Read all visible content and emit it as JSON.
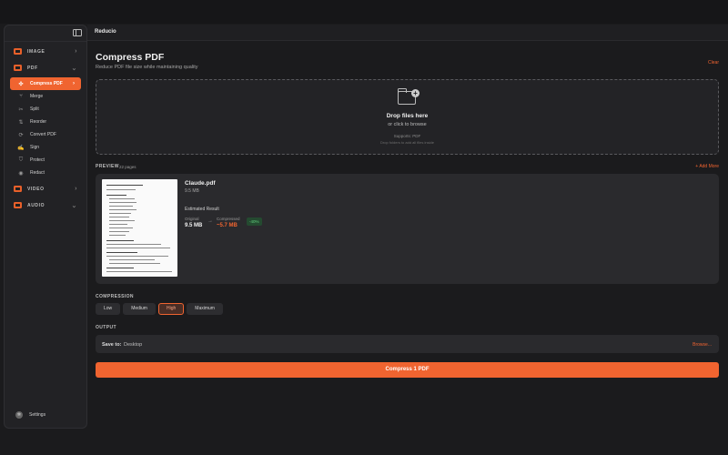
{
  "app": {
    "title": "Reducio"
  },
  "sidebar": {
    "sections": {
      "image": {
        "label": "IMAGE"
      },
      "pdf": {
        "label": "PDF",
        "items": [
          {
            "label": "Compress PDF"
          },
          {
            "label": "Merge"
          },
          {
            "label": "Split"
          },
          {
            "label": "Reorder"
          },
          {
            "label": "Convert PDF"
          },
          {
            "label": "Sign"
          },
          {
            "label": "Protect"
          },
          {
            "label": "Redact"
          }
        ]
      },
      "video": {
        "label": "VIDEO"
      },
      "audio": {
        "label": "AUDIO"
      }
    },
    "settings_label": "Settings"
  },
  "page": {
    "title": "Compress PDF",
    "subtitle": "Reduce PDF file size while maintaining quality",
    "clear_label": "Clear"
  },
  "dropzone": {
    "title": "Drop files here",
    "subtitle": "or click to browse",
    "supports": "Supports: PDF",
    "note": "Drop folders to add all files inside"
  },
  "preview": {
    "label": "PREVIEW",
    "page_count": "22 pages",
    "add_more_label": "+ Add More",
    "file_name": "Claude.pdf",
    "file_size": "9.5 MB",
    "estimated_label": "Estimated Result",
    "original_label": "Original",
    "original_value": "9.5 MB",
    "compressed_label": "Compressed",
    "compressed_value": "~5.7 MB",
    "reduction": "-40%"
  },
  "compression": {
    "label": "COMPRESSION",
    "levels": [
      "Low",
      "Medium",
      "High",
      "Maximum"
    ],
    "selected": "High"
  },
  "output": {
    "label": "OUTPUT",
    "save_label": "Save to:",
    "save_value": "Desktop",
    "browse_label": "Browse..."
  },
  "action": {
    "label": "Compress 1 PDF"
  },
  "colors": {
    "accent": "#f06430",
    "background": "#1b1b1d",
    "success": "#62d07e"
  }
}
